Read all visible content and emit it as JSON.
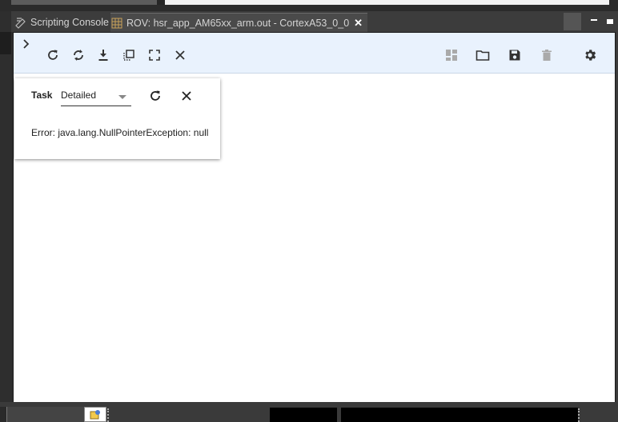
{
  "tabs": [
    {
      "label": "Scripting Console",
      "icon": "scripting-console-icon",
      "active": false
    },
    {
      "label": "ROV: hsr_app_AM65xx_arm.out - CortexA53_0_0",
      "icon": "rov-grid-icon",
      "active": true
    }
  ],
  "toolbar": {
    "left_buttons": [
      "refresh-icon",
      "sync-icon",
      "download-icon",
      "copy-select-icon",
      "fullscreen-icon",
      "close-icon"
    ],
    "right_buttons": [
      "dashboard-icon",
      "folder-icon",
      "save-icon",
      "trash-icon",
      "gear-icon"
    ]
  },
  "task_panel": {
    "label": "Task",
    "view_mode": "Detailed",
    "message": "Error: java.lang.NullPointerException: null"
  },
  "colors": {
    "toolbar_bg": "#e9f2fd",
    "panel_bg": "#ffffff",
    "ide_dark": "#3b3b3b",
    "icon": "#333333"
  }
}
